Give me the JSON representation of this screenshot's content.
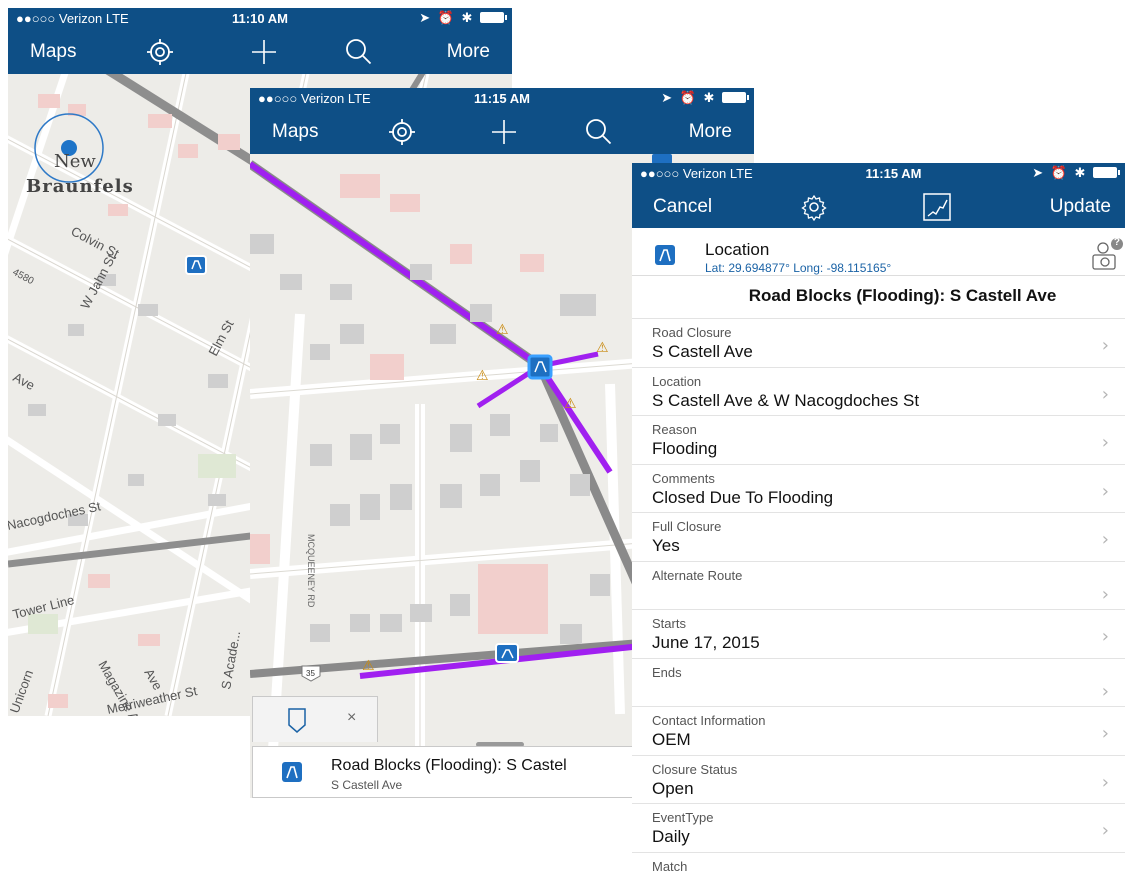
{
  "phone1": {
    "status": {
      "carrier": "●●○○○ Verizon  LTE",
      "time": "11:10 AM"
    },
    "nav": {
      "left": "Maps",
      "right": "More",
      "icons": [
        "locate-icon",
        "plus-icon",
        "search-icon"
      ]
    },
    "map": {
      "place_label_1": "New",
      "place_label_2": "Braunfels",
      "streets": [
        "Colvin St",
        "W Jahn St",
        "Elm St",
        "Ave",
        "Nacogdoches St",
        "Tower Line",
        "Magazine Ave",
        "S Acade...",
        "Unicorn",
        "Merriweather St",
        "4580",
        "Ave"
      ]
    }
  },
  "phone2": {
    "status": {
      "carrier": "●●○○○ Verizon  LTE",
      "time": "11:15 AM"
    },
    "nav": {
      "left": "Maps",
      "right": "More"
    },
    "map": {
      "street_label": "MCQUEENEY RD",
      "shield": "35"
    },
    "result": {
      "close": "×",
      "title": "Road Blocks (Flooding): S Castel",
      "subtitle": "S Castell Ave"
    }
  },
  "phone3": {
    "status": {
      "carrier": "●●○○○ Verizon  LTE",
      "time": "11:15 AM"
    },
    "nav": {
      "left": "Cancel",
      "right": "Update"
    },
    "location": {
      "title": "Location",
      "coords": "Lat: 29.694877° Long: -98.115165°",
      "badge": "?"
    },
    "form_title": "Road Blocks (Flooding): S Castell Ave",
    "fields": [
      {
        "label": "Road Closure",
        "value": "S Castell Ave"
      },
      {
        "label": "Location",
        "value": "S Castell Ave & W Nacogdoches St"
      },
      {
        "label": "Reason",
        "value": "Flooding"
      },
      {
        "label": "Comments",
        "value": "Closed Due To Flooding"
      },
      {
        "label": "Full Closure",
        "value": "Yes"
      },
      {
        "label": "Alternate Route",
        "value": ""
      },
      {
        "label": "Starts",
        "value": "June 17, 2015"
      },
      {
        "label": "Ends",
        "value": ""
      },
      {
        "label": "Contact Information",
        "value": "OEM"
      },
      {
        "label": "Closure Status",
        "value": "Open"
      },
      {
        "label": "EventType",
        "value": "Daily"
      },
      {
        "label": "Match",
        "value": ""
      }
    ],
    "chevron": "›"
  },
  "colors": {
    "navbar": "#0e4f86",
    "route": "#a020f0",
    "road": "#8e8e8e",
    "building_red": "#f2cfcc",
    "building_gray": "#cfcfcf"
  }
}
